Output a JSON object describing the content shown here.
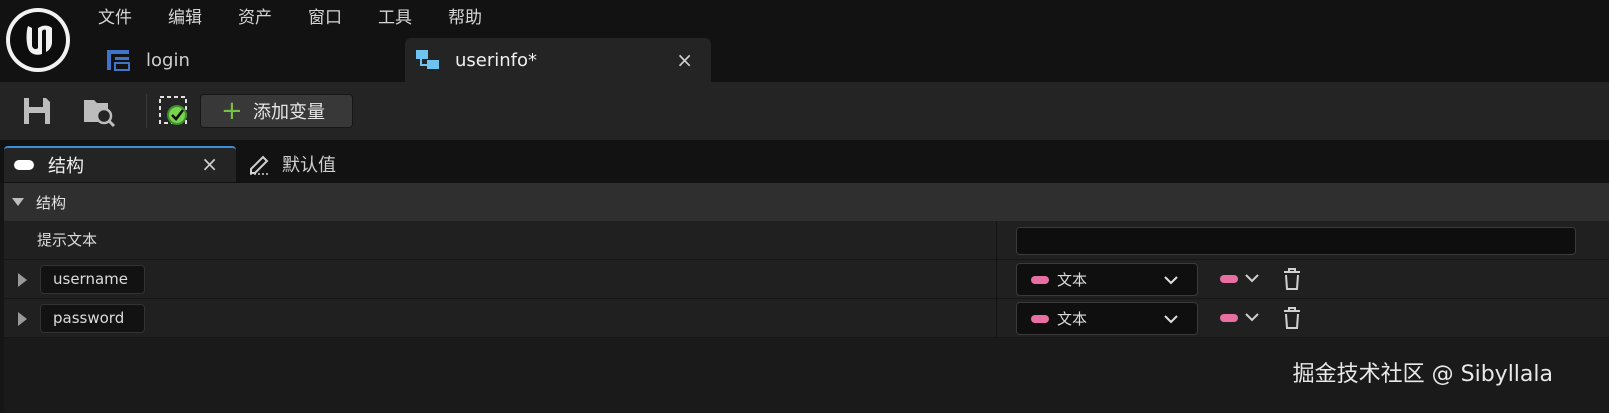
{
  "menu": [
    "文件",
    "编辑",
    "资产",
    "窗口",
    "工具",
    "帮助"
  ],
  "doc_tabs": [
    {
      "label": "login",
      "active": false,
      "icon": "struct-icon"
    },
    {
      "label": "userinfo*",
      "active": true,
      "icon": "blueprint-struct-icon",
      "close": "×"
    }
  ],
  "toolbar": {
    "save_icon": "save-icon",
    "browse_icon": "browse-folder-icon",
    "status_icon": "compile-status-icon",
    "add_variable_label": "添加变量"
  },
  "panel_tabs": [
    {
      "label": "结构",
      "active": true,
      "close": "×",
      "icon": "struct-pill-icon"
    },
    {
      "label": "默认值",
      "active": false,
      "icon": "edit-defaults-icon"
    }
  ],
  "details": {
    "category_label": "结构",
    "hint_label": "提示文本",
    "hint_value": "",
    "variables": [
      {
        "name": "username",
        "type": "文本"
      },
      {
        "name": "password",
        "type": "文本"
      }
    ]
  },
  "colors": {
    "text_type": "#e76fa2",
    "active_tab_accent": "#3a8fd6",
    "add_plus": "#77c043"
  },
  "watermark": "掘金技术社区 @ Sibyllala"
}
